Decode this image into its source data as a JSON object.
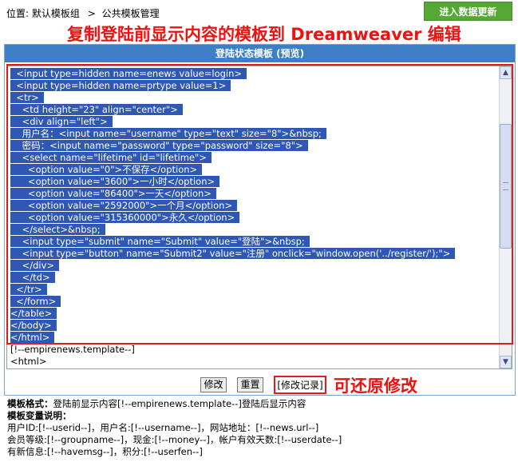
{
  "breadcrumb": {
    "prefix": "位置:",
    "group": "默认模板组",
    "separator": ">",
    "current": "公共模板管理"
  },
  "enter_data_button": "进入数据更新",
  "headline": "复制登陆前显示内容的模板到 Dreamweaver 编辑",
  "panel_title": "登陆状态模板 (预览)",
  "code_lines_selected": [
    "  <input type=hidden name=enews value=login>",
    "  <input type=hidden name=prtype value=1>",
    "  <tr>",
    "    <td height=\"23\" align=\"center\">",
    "    <div align=\"left\">",
    "    用户名：<input name=\"username\" type=\"text\" size=\"8\">&nbsp;",
    "    密码：<input name=\"password\" type=\"password\" size=\"8\">",
    "    <select name=\"lifetime\" id=\"lifetime\">",
    "      <option value=\"0\">不保存</option>",
    "      <option value=\"3600\">一小时</option>",
    "      <option value=\"86400\">一天</option>",
    "      <option value=\"2592000\">一个月</option>",
    "      <option value=\"315360000\">永久</option>",
    "    </select>&nbsp;",
    "    <input type=\"submit\" name=\"Submit\" value=\"登陆\">&nbsp;",
    "    <input type=\"button\" name=\"Submit2\" value=\"注册\" onclick=\"window.open('../register/');\">",
    "    </div>",
    "    </td>",
    "  </tr>",
    "  </form>",
    "</table>",
    "</body>",
    "</html>"
  ],
  "code_lines_plain": [
    "[!--empirenews.template--]",
    "<html>"
  ],
  "buttons": {
    "modify": "修改",
    "reset": "重置",
    "history": "[修改记录]"
  },
  "restore_note": "可还原修改",
  "notes": {
    "format_label": "模板格式：",
    "format_text": "登陆前显示内容[!--empirenews.template--]登陆后显示内容",
    "vars_label": "模板变量说明：",
    "vars_line1": "用户ID:[!--userid--]，用户名:[!--username--]，网站地址：[!--news.url--]",
    "vars_line2": "会员等级:[!--groupname--]，现金:[!--money--]，帐户有效天数:[!--userdate--]",
    "vars_line3": "有新信息:[!--havemsg--]，积分:[!--userfen--]"
  },
  "colors": {
    "header_bg": "#3d7fc6",
    "selection_bg": "#2f57b5",
    "accent_red": "#e21b1b",
    "button_green": "#56a835"
  }
}
